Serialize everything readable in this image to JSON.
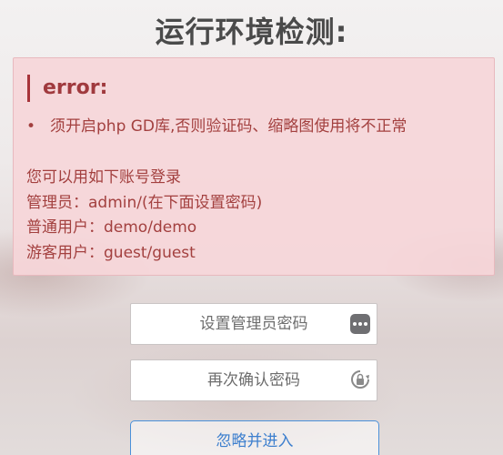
{
  "page": {
    "title": "运行环境检测:"
  },
  "alert": {
    "heading": "error:",
    "errors": [
      "须开启php GD库,否则验证码、缩略图使用将不正常"
    ],
    "info_lines": [
      "您可以用如下账号登录",
      "管理员：admin/(在下面设置密码)",
      "普通用户：demo/demo",
      "游客用户：guest/guest"
    ]
  },
  "form": {
    "admin_password": {
      "placeholder": "设置管理员密码",
      "value": "",
      "icon": "password-dots-icon"
    },
    "confirm_password": {
      "placeholder": "再次确认密码",
      "value": "",
      "icon": "password-key-icon"
    },
    "submit_label": "忽略并进入"
  },
  "colors": {
    "error_text": "#a3403f",
    "alert_background": "#f6d6d9",
    "alert_accent": "#a7343a",
    "button_accent": "#3d7fce"
  }
}
